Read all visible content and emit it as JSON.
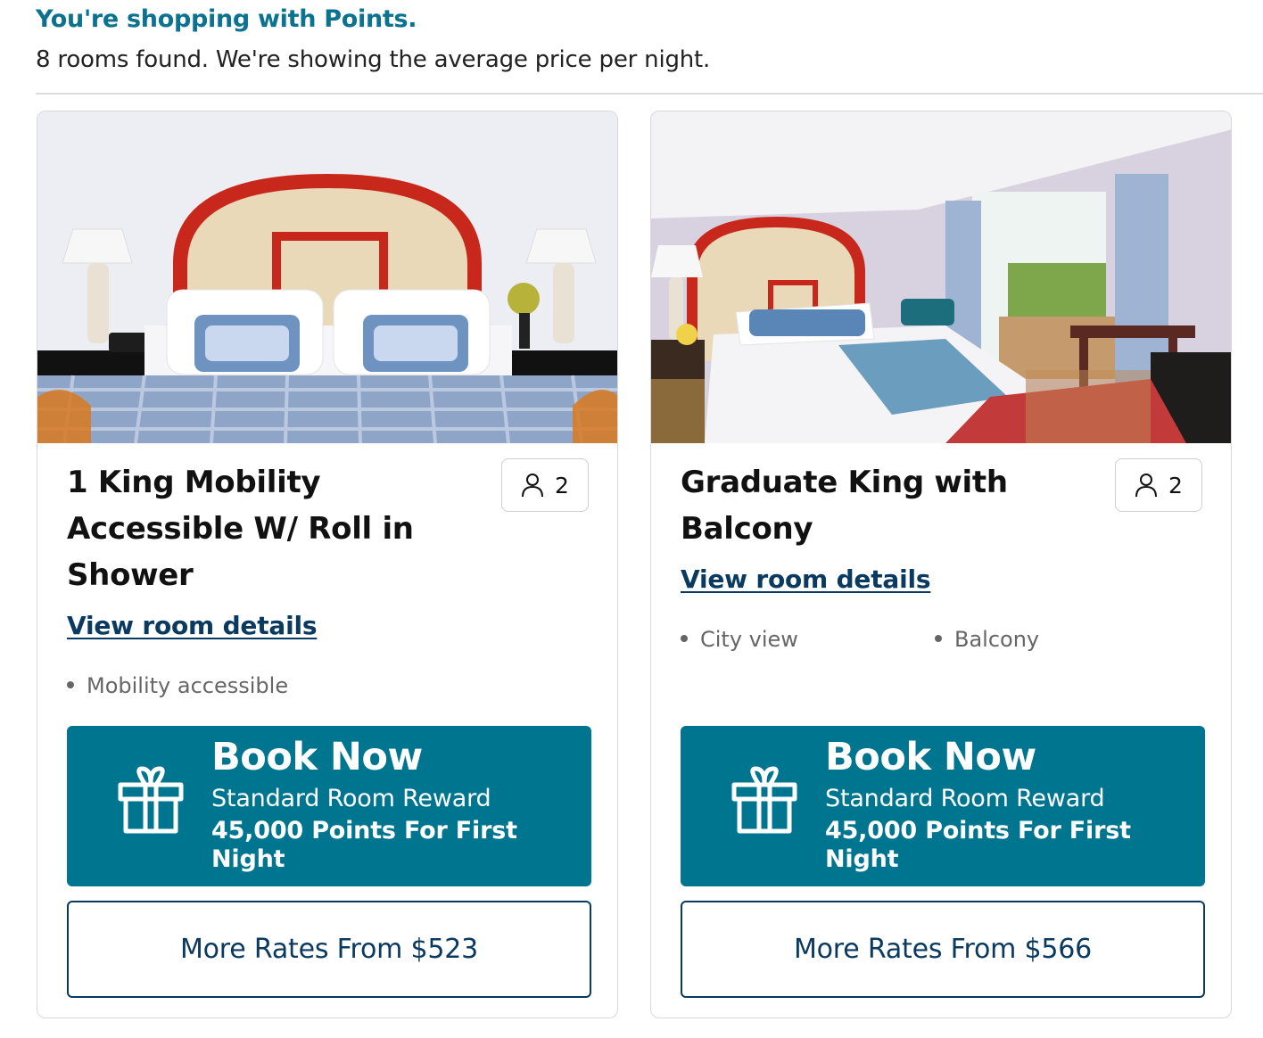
{
  "header": {
    "shopping_notice": "You're shopping with Points.",
    "rooms_found": "8 rooms found. We're showing the average price per night."
  },
  "rooms": [
    {
      "title": "1 King Mobility Accessible W/ Roll in Shower",
      "occupancy": "2",
      "details_link": "View room details",
      "amenities": [
        "Mobility accessible"
      ],
      "book_now_label": "Book Now",
      "reward_type": "Standard Room Reward",
      "reward_points": "45,000 Points For First Night",
      "more_rates": "More Rates From $523"
    },
    {
      "title": "Graduate King with Balcony",
      "occupancy": "2",
      "details_link": "View room details",
      "amenities": [
        "City view",
        "Balcony"
      ],
      "book_now_label": "Book Now",
      "reward_type": "Standard Room Reward",
      "reward_points": "45,000 Points For First Night",
      "more_rates": "More Rates From $566"
    }
  ],
  "colors": {
    "accent": "#0b7290",
    "button_bg": "#00758f",
    "link": "#0a3a60",
    "headboard_red": "#c8281c"
  },
  "icons": {
    "occupancy": "person-icon",
    "reward": "gift-icon"
  }
}
